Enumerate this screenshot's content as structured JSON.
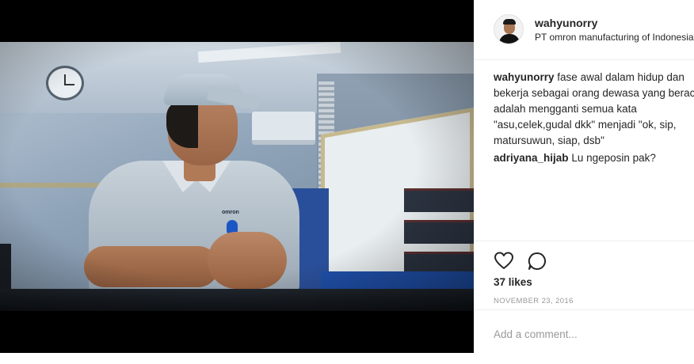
{
  "post": {
    "username": "wahyunorry",
    "location": "PT omron manufacturing of Indonesia",
    "shirt_logo": "omron"
  },
  "comments": [
    {
      "user": "wahyunorry",
      "lines": [
        "fase awal dalam hidup dan",
        "bekerja sebagai orang dewasa yang berac",
        "adalah mengganti semua kata",
        "\"asu,celek,gudal dkk\" menjadi \"ok, sip,",
        "matursuwun, siap, dsb\""
      ]
    },
    {
      "user": "adriyana_hijab",
      "text": "Lu ngeposin pak?"
    }
  ],
  "actions": {
    "likes": "37 likes",
    "date": "NOVEMBER 23, 2016",
    "like_icon": "heart-outline-icon",
    "comment_icon": "speech-bubble-icon"
  },
  "add_comment": {
    "placeholder": "Add a comment..."
  }
}
